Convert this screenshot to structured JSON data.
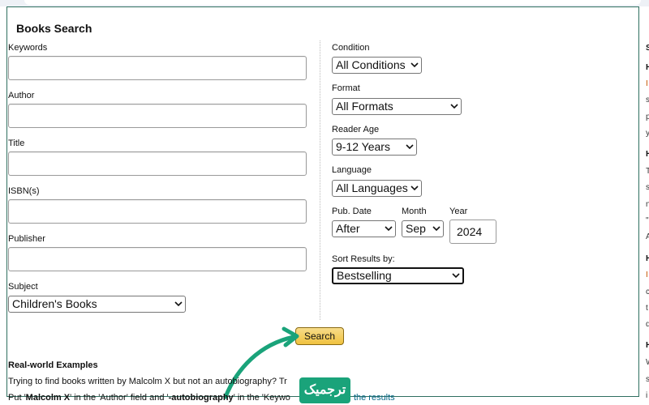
{
  "form": {
    "title": "Books Search",
    "keywords_label": "Keywords",
    "author_label": "Author",
    "title_label": "Title",
    "isbn_label": "ISBN(s)",
    "publisher_label": "Publisher",
    "subject_label": "Subject",
    "subject_value": "Children's Books",
    "condition_label": "Condition",
    "condition_value": "All Conditions",
    "format_label": "Format",
    "format_value": "All Formats",
    "reader_age_label": "Reader Age",
    "reader_age_value": "9-12 Years",
    "language_label": "Language",
    "language_value": "All Languages",
    "pub_date_label": "Pub. Date",
    "pub_date_value": "After",
    "month_label": "Month",
    "month_value": "Sep",
    "year_label": "Year",
    "year_value": "2024",
    "sort_label": "Sort Results by:",
    "sort_value": "Bestselling",
    "search_button": "Search"
  },
  "examples": {
    "heading": "Real-world Examples",
    "line1": "Trying to find books written by Malcolm X but not an autobiography? Tr",
    "line2_a": "Put '",
    "line2_b": "Malcolm X",
    "line2_c": "' in the 'Author' field and '",
    "line2_d": "-autobiography",
    "line2_e": "' in the 'Keywo",
    "line2_link": "the results"
  },
  "watermark": "ترجمیک",
  "colors": {
    "accent": "#1aa37a",
    "panel_border": "#2f6f60",
    "button_gold": "#f0c23f",
    "link": "#0a6a8a"
  }
}
